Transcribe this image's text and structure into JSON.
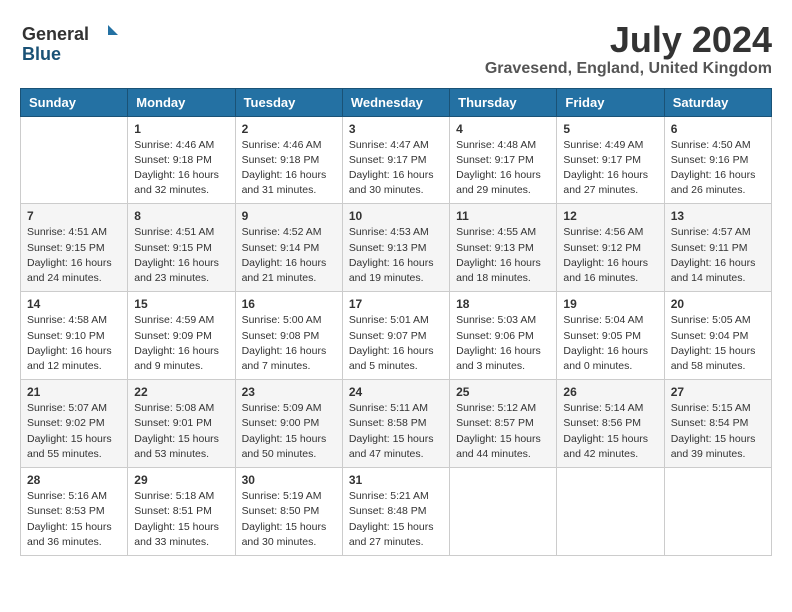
{
  "header": {
    "logo_general": "General",
    "logo_blue": "Blue",
    "month_title": "July 2024",
    "location": "Gravesend, England, United Kingdom"
  },
  "weekdays": [
    "Sunday",
    "Monday",
    "Tuesday",
    "Wednesday",
    "Thursday",
    "Friday",
    "Saturday"
  ],
  "weeks": [
    [
      {
        "day": "",
        "info": ""
      },
      {
        "day": "1",
        "info": "Sunrise: 4:46 AM\nSunset: 9:18 PM\nDaylight: 16 hours\nand 32 minutes."
      },
      {
        "day": "2",
        "info": "Sunrise: 4:46 AM\nSunset: 9:18 PM\nDaylight: 16 hours\nand 31 minutes."
      },
      {
        "day": "3",
        "info": "Sunrise: 4:47 AM\nSunset: 9:17 PM\nDaylight: 16 hours\nand 30 minutes."
      },
      {
        "day": "4",
        "info": "Sunrise: 4:48 AM\nSunset: 9:17 PM\nDaylight: 16 hours\nand 29 minutes."
      },
      {
        "day": "5",
        "info": "Sunrise: 4:49 AM\nSunset: 9:17 PM\nDaylight: 16 hours\nand 27 minutes."
      },
      {
        "day": "6",
        "info": "Sunrise: 4:50 AM\nSunset: 9:16 PM\nDaylight: 16 hours\nand 26 minutes."
      }
    ],
    [
      {
        "day": "7",
        "info": "Sunrise: 4:51 AM\nSunset: 9:15 PM\nDaylight: 16 hours\nand 24 minutes."
      },
      {
        "day": "8",
        "info": "Sunrise: 4:51 AM\nSunset: 9:15 PM\nDaylight: 16 hours\nand 23 minutes."
      },
      {
        "day": "9",
        "info": "Sunrise: 4:52 AM\nSunset: 9:14 PM\nDaylight: 16 hours\nand 21 minutes."
      },
      {
        "day": "10",
        "info": "Sunrise: 4:53 AM\nSunset: 9:13 PM\nDaylight: 16 hours\nand 19 minutes."
      },
      {
        "day": "11",
        "info": "Sunrise: 4:55 AM\nSunset: 9:13 PM\nDaylight: 16 hours\nand 18 minutes."
      },
      {
        "day": "12",
        "info": "Sunrise: 4:56 AM\nSunset: 9:12 PM\nDaylight: 16 hours\nand 16 minutes."
      },
      {
        "day": "13",
        "info": "Sunrise: 4:57 AM\nSunset: 9:11 PM\nDaylight: 16 hours\nand 14 minutes."
      }
    ],
    [
      {
        "day": "14",
        "info": "Sunrise: 4:58 AM\nSunset: 9:10 PM\nDaylight: 16 hours\nand 12 minutes."
      },
      {
        "day": "15",
        "info": "Sunrise: 4:59 AM\nSunset: 9:09 PM\nDaylight: 16 hours\nand 9 minutes."
      },
      {
        "day": "16",
        "info": "Sunrise: 5:00 AM\nSunset: 9:08 PM\nDaylight: 16 hours\nand 7 minutes."
      },
      {
        "day": "17",
        "info": "Sunrise: 5:01 AM\nSunset: 9:07 PM\nDaylight: 16 hours\nand 5 minutes."
      },
      {
        "day": "18",
        "info": "Sunrise: 5:03 AM\nSunset: 9:06 PM\nDaylight: 16 hours\nand 3 minutes."
      },
      {
        "day": "19",
        "info": "Sunrise: 5:04 AM\nSunset: 9:05 PM\nDaylight: 16 hours\nand 0 minutes."
      },
      {
        "day": "20",
        "info": "Sunrise: 5:05 AM\nSunset: 9:04 PM\nDaylight: 15 hours\nand 58 minutes."
      }
    ],
    [
      {
        "day": "21",
        "info": "Sunrise: 5:07 AM\nSunset: 9:02 PM\nDaylight: 15 hours\nand 55 minutes."
      },
      {
        "day": "22",
        "info": "Sunrise: 5:08 AM\nSunset: 9:01 PM\nDaylight: 15 hours\nand 53 minutes."
      },
      {
        "day": "23",
        "info": "Sunrise: 5:09 AM\nSunset: 9:00 PM\nDaylight: 15 hours\nand 50 minutes."
      },
      {
        "day": "24",
        "info": "Sunrise: 5:11 AM\nSunset: 8:58 PM\nDaylight: 15 hours\nand 47 minutes."
      },
      {
        "day": "25",
        "info": "Sunrise: 5:12 AM\nSunset: 8:57 PM\nDaylight: 15 hours\nand 44 minutes."
      },
      {
        "day": "26",
        "info": "Sunrise: 5:14 AM\nSunset: 8:56 PM\nDaylight: 15 hours\nand 42 minutes."
      },
      {
        "day": "27",
        "info": "Sunrise: 5:15 AM\nSunset: 8:54 PM\nDaylight: 15 hours\nand 39 minutes."
      }
    ],
    [
      {
        "day": "28",
        "info": "Sunrise: 5:16 AM\nSunset: 8:53 PM\nDaylight: 15 hours\nand 36 minutes."
      },
      {
        "day": "29",
        "info": "Sunrise: 5:18 AM\nSunset: 8:51 PM\nDaylight: 15 hours\nand 33 minutes."
      },
      {
        "day": "30",
        "info": "Sunrise: 5:19 AM\nSunset: 8:50 PM\nDaylight: 15 hours\nand 30 minutes."
      },
      {
        "day": "31",
        "info": "Sunrise: 5:21 AM\nSunset: 8:48 PM\nDaylight: 15 hours\nand 27 minutes."
      },
      {
        "day": "",
        "info": ""
      },
      {
        "day": "",
        "info": ""
      },
      {
        "day": "",
        "info": ""
      }
    ]
  ]
}
